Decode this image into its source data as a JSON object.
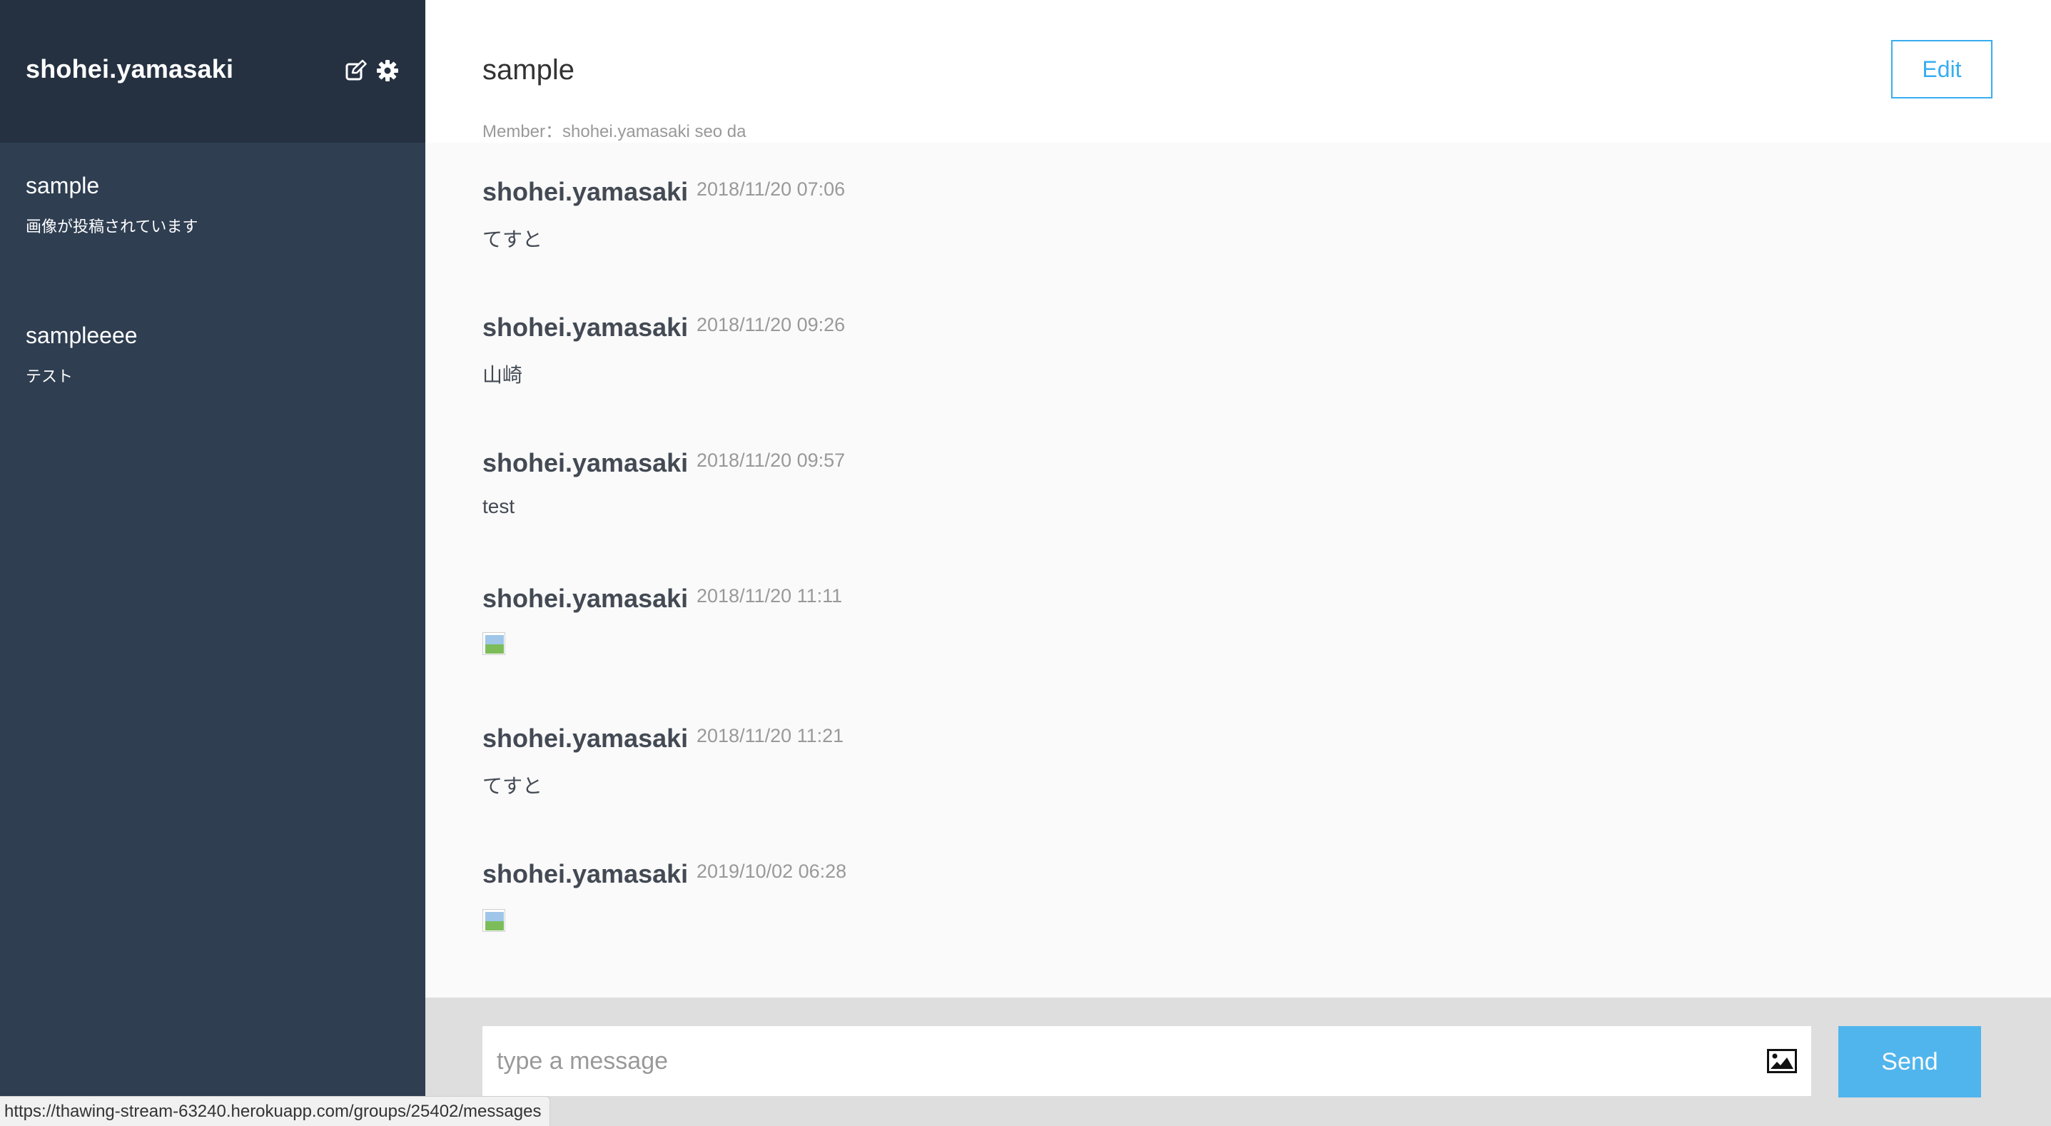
{
  "sidebar": {
    "user_name": "shohei.yamasaki",
    "icons": [
      "edit-icon",
      "gear-icon"
    ],
    "groups": [
      {
        "name": "sample",
        "last_message": "画像が投稿されています"
      },
      {
        "name": "sampleeee",
        "last_message": "テスト"
      }
    ]
  },
  "header": {
    "group_name": "sample",
    "members": "Member：shohei.yamasaki seo da",
    "edit_label": "Edit"
  },
  "messages": [
    {
      "user": "shohei.yamasaki",
      "date": "2018/11/20 07:06",
      "text": "てすと"
    },
    {
      "user": "shohei.yamasaki",
      "date": "2018/11/20 09:26",
      "text": "山崎"
    },
    {
      "user": "shohei.yamasaki",
      "date": "2018/11/20 09:57",
      "text": "test"
    },
    {
      "user": "shohei.yamasaki",
      "date": "2018/11/20 11:11",
      "image": "broken-image-icon"
    },
    {
      "user": "shohei.yamasaki",
      "date": "2018/11/20 11:21",
      "text": "てすと"
    },
    {
      "user": "shohei.yamasaki",
      "date": "2019/10/02 06:28",
      "image": "broken-image-icon"
    }
  ],
  "footer": {
    "placeholder": "type a message",
    "value": "",
    "image_icon": "image-icon",
    "send_label": "Send"
  },
  "status_bar": {
    "url": "https://thawing-stream-63240.herokuapp.com/groups/25402/messages"
  },
  "colors": {
    "sidebar_bg": "#2f3e51",
    "sidebar_header_bg": "#253141",
    "accent": "#38aef0",
    "footer_bg": "#dedede"
  }
}
